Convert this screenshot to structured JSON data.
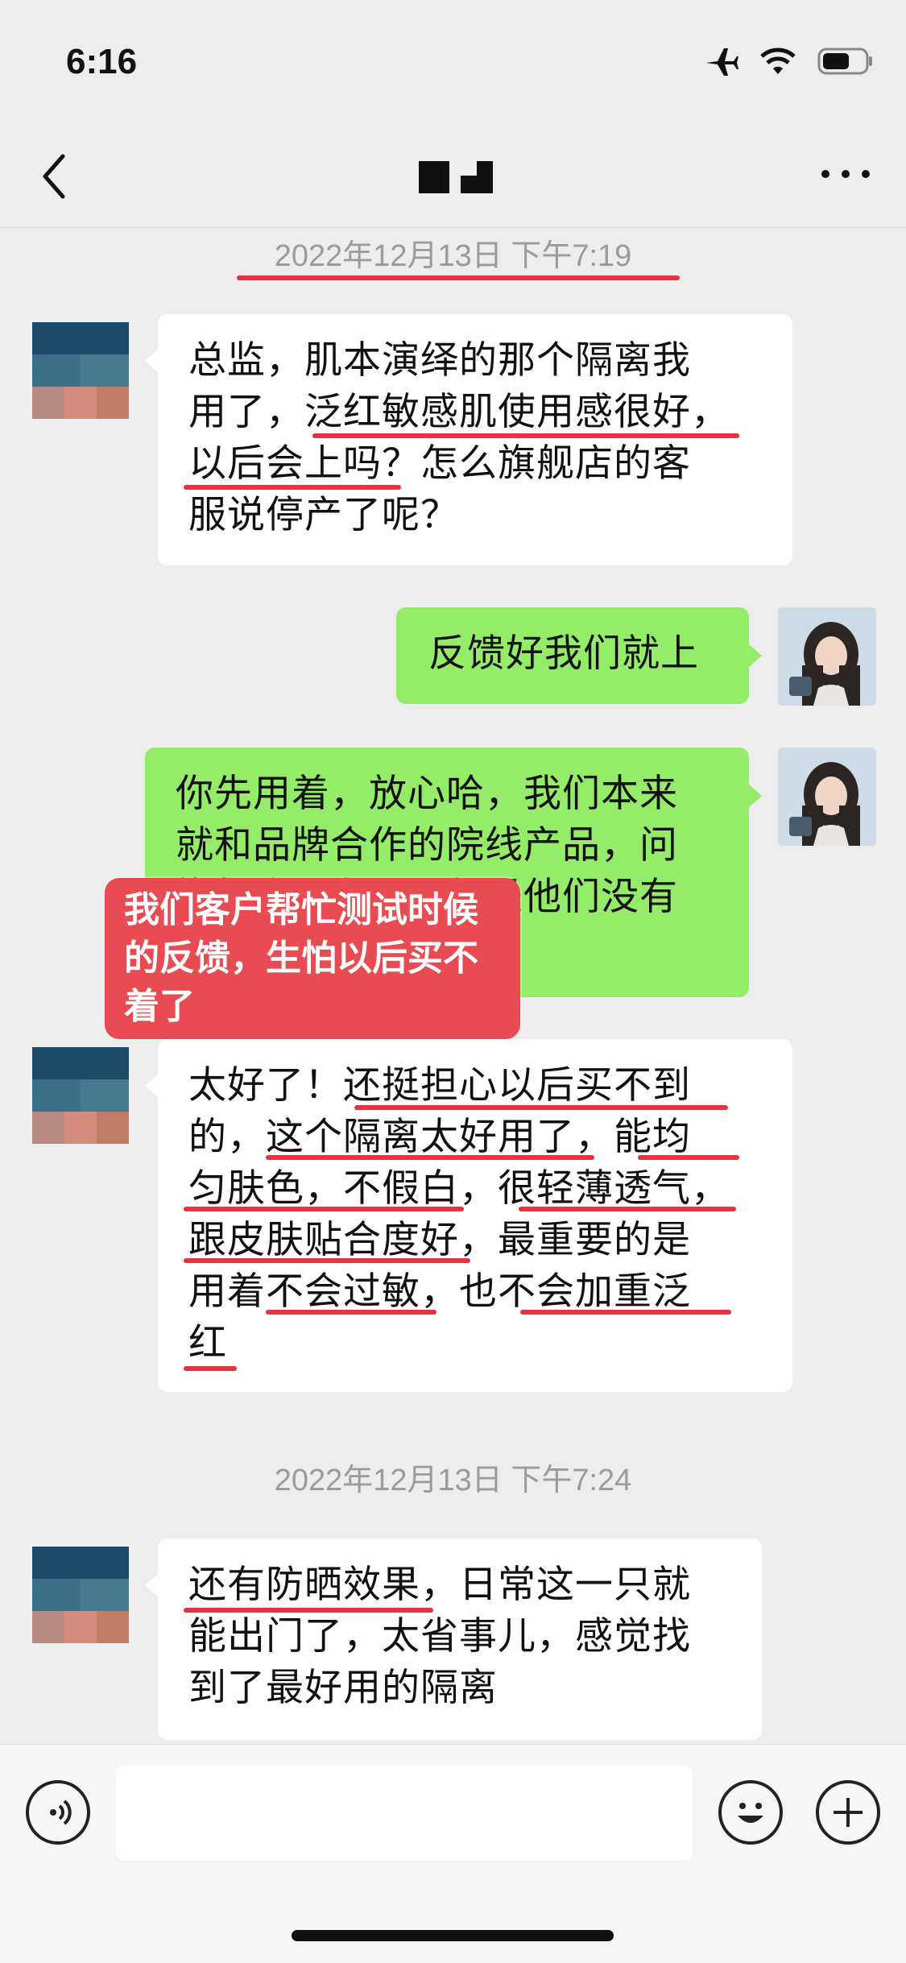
{
  "status_bar": {
    "time": "6:16",
    "icons": [
      "airplane-icon",
      "wifi-icon",
      "battery-icon"
    ]
  },
  "nav": {
    "title_redacted": true,
    "back_icon": "chevron-left-icon",
    "more_icon": "more-dots-icon"
  },
  "timestamps": [
    "2022年12月13日 下午7:19",
    "2022年12月13日 下午7:24"
  ],
  "messages": [
    {
      "side": "left",
      "text": "总监，肌本演绎的那个隔离我\n用了，泛红敏感肌使用感很好，\n以后会上吗？怎么旗舰店的客\n服说停产了呢？"
    },
    {
      "side": "right",
      "text": "反馈好我们就上"
    },
    {
      "side": "right",
      "text": "你先用着，放心哈，我们本来\n就和品牌合作的院线产品，问\n旗舰店没有用，都是他们没有\n产品"
    },
    {
      "side": "left",
      "text": "太好了！还挺担心以后买不到\n的，这个隔离太好用了，能均\n匀肤色，不假白，很轻薄透气，\n跟皮肤贴合度好，最重要的是\n用着不会过敏，也不会加重泛\n红"
    },
    {
      "side": "left",
      "text": "还有防晒效果，日常这一只就\n能出门了，太省事儿，感觉找\n到了最好用的隔离"
    }
  ],
  "annotation": {
    "text": "我们客户帮忙测试时候\n的反馈，生怕以后买不\n着了",
    "color": "#e84c52"
  },
  "input_bar": {
    "voice_icon": "voice-icon",
    "emoji_icon": "emoji-icon",
    "plus_icon": "plus-icon"
  },
  "colors": {
    "bubble_green": "#95ec69",
    "underline_red": "#e5333f",
    "background": "#ededed"
  }
}
